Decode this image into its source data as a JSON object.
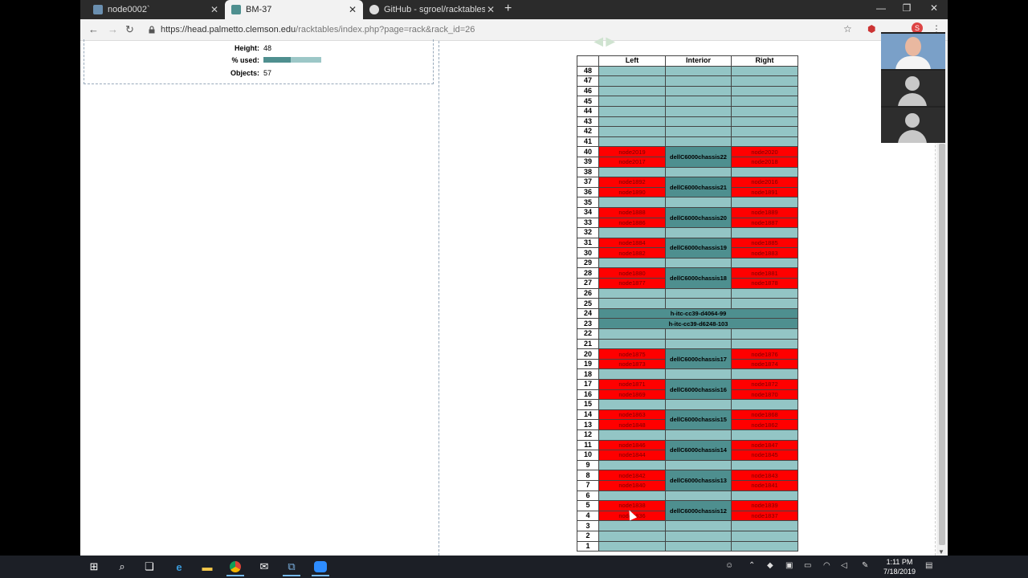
{
  "browser": {
    "tabs": [
      {
        "label": "node0002`",
        "active": false
      },
      {
        "label": "BM-37",
        "active": true
      },
      {
        "label": "GitHub - sgroel/racktables: Rack",
        "active": false
      }
    ],
    "new_tab": "+",
    "url_host": "https://head.palmetto.clemson.edu",
    "url_path": "/racktables/index.php?page=rack&rack_id=26",
    "profile_letter": "S"
  },
  "rack_info": {
    "height_label": "Height:",
    "height_value": "48",
    "used_label": "% used:",
    "used_fraction": 0.47,
    "objects_label": "Objects:",
    "objects_value": "57"
  },
  "rack": {
    "headers": [
      "",
      "Left",
      "Interior",
      "Right"
    ],
    "units": [
      {
        "u": "48",
        "type": "free"
      },
      {
        "u": "47",
        "type": "free"
      },
      {
        "u": "46",
        "type": "free"
      },
      {
        "u": "45",
        "type": "free"
      },
      {
        "u": "44",
        "type": "free"
      },
      {
        "u": "43",
        "type": "free"
      },
      {
        "u": "42",
        "type": "free"
      },
      {
        "u": "41",
        "type": "free"
      },
      {
        "u": "40",
        "type": "top",
        "left": "node2019",
        "chassis": "dellC6000chassis22",
        "right": "node2020"
      },
      {
        "u": "39",
        "type": "bottom",
        "left": "node2017",
        "right": "node2018"
      },
      {
        "u": "38",
        "type": "free"
      },
      {
        "u": "37",
        "type": "top",
        "left": "node1892",
        "chassis": "dellC6000chassis21",
        "right": "node2016"
      },
      {
        "u": "36",
        "type": "bottom",
        "left": "node1890",
        "right": "node1891"
      },
      {
        "u": "35",
        "type": "free"
      },
      {
        "u": "34",
        "type": "top",
        "left": "node1888",
        "chassis": "dellC6000chassis20",
        "right": "node1889"
      },
      {
        "u": "33",
        "type": "bottom",
        "left": "node1886",
        "right": "node1887"
      },
      {
        "u": "32",
        "type": "free"
      },
      {
        "u": "31",
        "type": "top",
        "left": "node1884",
        "chassis": "dellC6000chassis19",
        "right": "node1885"
      },
      {
        "u": "30",
        "type": "bottom",
        "left": "node1882",
        "right": "node1883"
      },
      {
        "u": "29",
        "type": "free"
      },
      {
        "u": "28",
        "type": "top",
        "left": "node1880",
        "chassis": "dellC6000chassis18",
        "right": "node1881"
      },
      {
        "u": "27",
        "type": "bottom",
        "left": "node1877",
        "right": "node1878"
      },
      {
        "u": "26",
        "type": "free"
      },
      {
        "u": "25",
        "type": "free"
      },
      {
        "u": "24",
        "type": "full",
        "name": "h-itc-cc39-d4064-99"
      },
      {
        "u": "23",
        "type": "full",
        "name": "h-itc-cc39-d6248-103"
      },
      {
        "u": "22",
        "type": "free"
      },
      {
        "u": "21",
        "type": "free"
      },
      {
        "u": "20",
        "type": "top",
        "left": "node1875",
        "chassis": "dellC6000chassis17",
        "right": "node1876"
      },
      {
        "u": "19",
        "type": "bottom",
        "left": "node1873",
        "right": "node1874"
      },
      {
        "u": "18",
        "type": "free"
      },
      {
        "u": "17",
        "type": "top",
        "left": "node1871",
        "chassis": "dellC6000chassis16",
        "right": "node1872"
      },
      {
        "u": "16",
        "type": "bottom",
        "left": "node1869",
        "right": "node1870"
      },
      {
        "u": "15",
        "type": "free"
      },
      {
        "u": "14",
        "type": "top",
        "left": "node1863",
        "chassis": "dellC6000chassis15",
        "right": "node1868"
      },
      {
        "u": "13",
        "type": "bottom",
        "left": "node1848",
        "right": "node1862"
      },
      {
        "u": "12",
        "type": "free"
      },
      {
        "u": "11",
        "type": "top",
        "left": "node1846",
        "chassis": "dellC6000chassis14",
        "right": "node1847"
      },
      {
        "u": "10",
        "type": "bottom",
        "left": "node1844",
        "right": "node1845"
      },
      {
        "u": "9",
        "type": "free"
      },
      {
        "u": "8",
        "type": "top",
        "left": "node1842",
        "chassis": "dellC6000chassis13",
        "right": "node1843"
      },
      {
        "u": "7",
        "type": "bottom",
        "left": "node1840",
        "right": "node1841"
      },
      {
        "u": "6",
        "type": "free"
      },
      {
        "u": "5",
        "type": "top",
        "left": "node1838",
        "chassis": "dellC6000chassis12",
        "right": "node1839"
      },
      {
        "u": "4",
        "type": "bottom",
        "left": "node1836",
        "right": "node1837"
      },
      {
        "u": "3",
        "type": "free"
      },
      {
        "u": "2",
        "type": "free"
      },
      {
        "u": "1",
        "type": "free"
      }
    ]
  },
  "colors": {
    "free": "#93c5c5",
    "node": "#ff0000",
    "chassis": "#4e8f8f"
  },
  "taskbar": {
    "time": "1:11 PM",
    "date": "7/18/2019",
    "apps": [
      "windows-start-icon",
      "search-icon",
      "task-view-icon",
      "edge-icon",
      "file-explorer-icon",
      "chrome-icon",
      "mail-icon",
      "network-app-icon",
      "zoom-icon"
    ]
  }
}
